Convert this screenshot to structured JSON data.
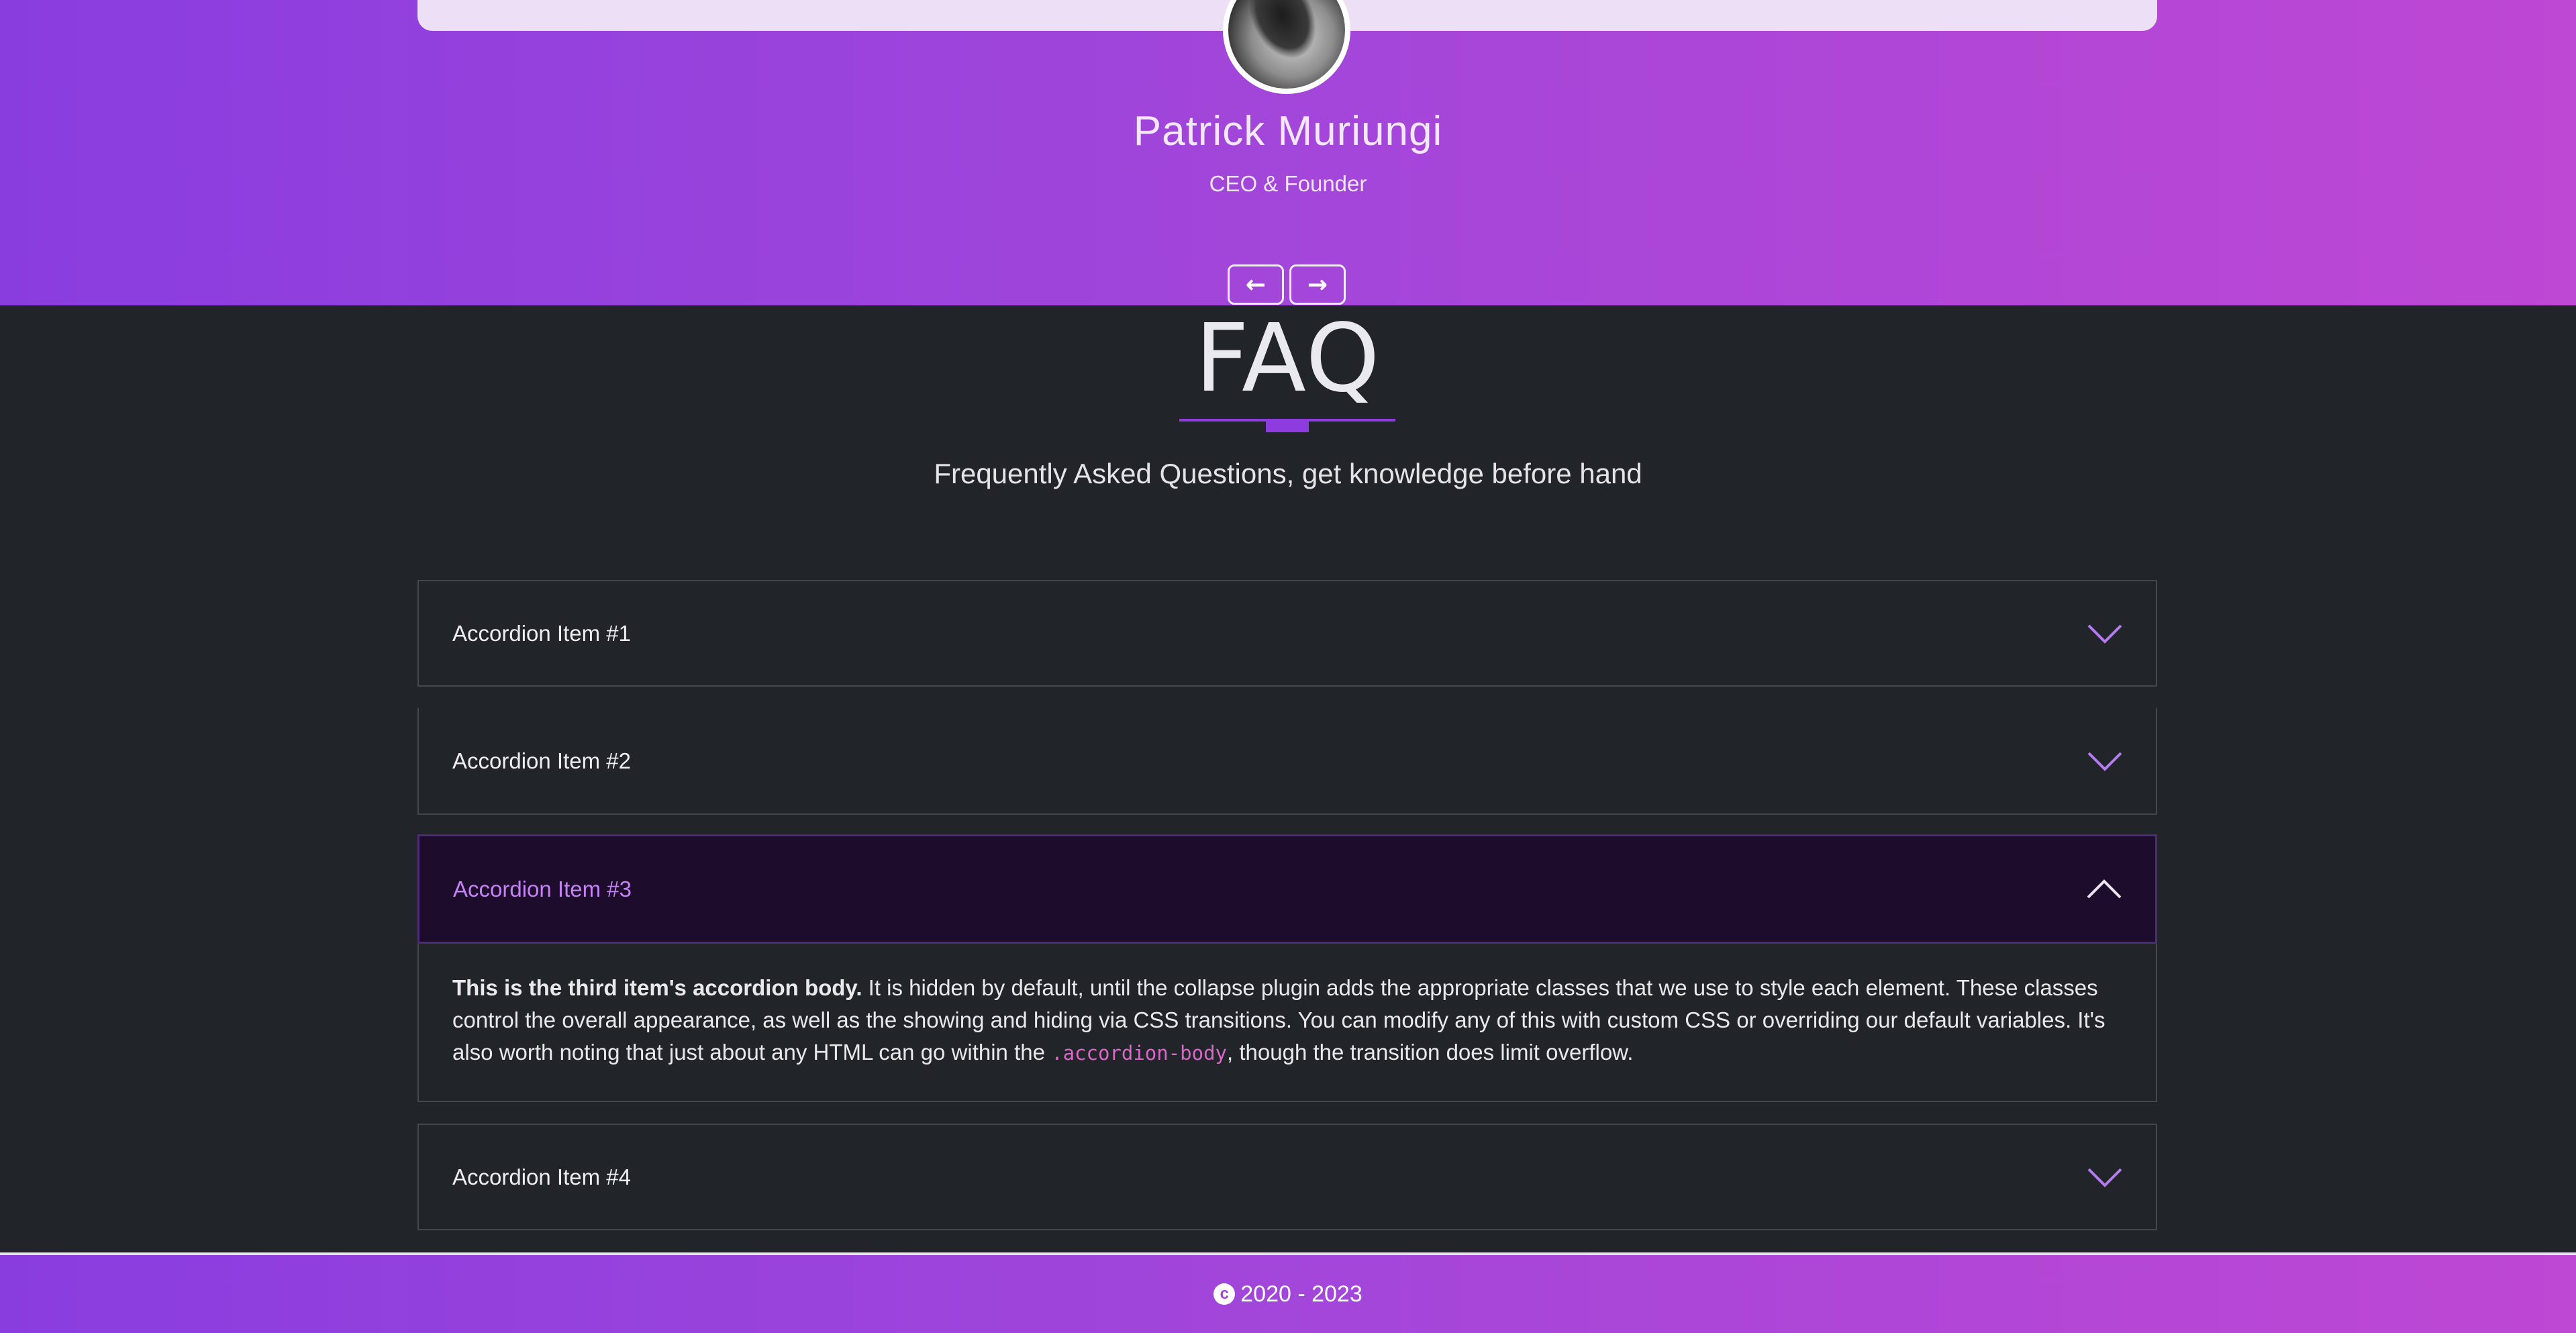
{
  "testimonial": {
    "name": "Patrick Muriungi",
    "role": "CEO & Founder",
    "prev_glyph": "←",
    "next_glyph": "→",
    "avatar_icon": "avatar-photo"
  },
  "faq": {
    "title": "FAQ",
    "subtitle": "Frequently Asked Questions, get knowledge before hand",
    "items": [
      {
        "label": "Accordion Item #1",
        "expanded": false
      },
      {
        "label": "Accordion Item #2",
        "expanded": false
      },
      {
        "label": "Accordion Item #3",
        "expanded": true
      },
      {
        "label": "Accordion Item #4",
        "expanded": false
      }
    ],
    "body": {
      "strong": "This is the third item's accordion body.",
      "text_1": " It is hidden by default, until the collapse plugin adds the appropriate classes that we use to style each element. These classes control the overall appearance, as well as the showing and hiding via CSS transitions. You can modify any of this with custom CSS or overriding our default variables. It's also worth noting that just about any HTML can go within the ",
      "code": ".accordion-body",
      "text_2": ", though the transition does limit overflow."
    }
  },
  "footer": {
    "copyright_glyph": "c",
    "text": "2020 - 2023"
  },
  "colors": {
    "accent": "#8e3be0",
    "gradient_start": "#8a3ddf",
    "gradient_end": "#be47d4",
    "active_label": "#c482f4",
    "chevron": "#b77bf0",
    "page_bg": "#212529"
  }
}
